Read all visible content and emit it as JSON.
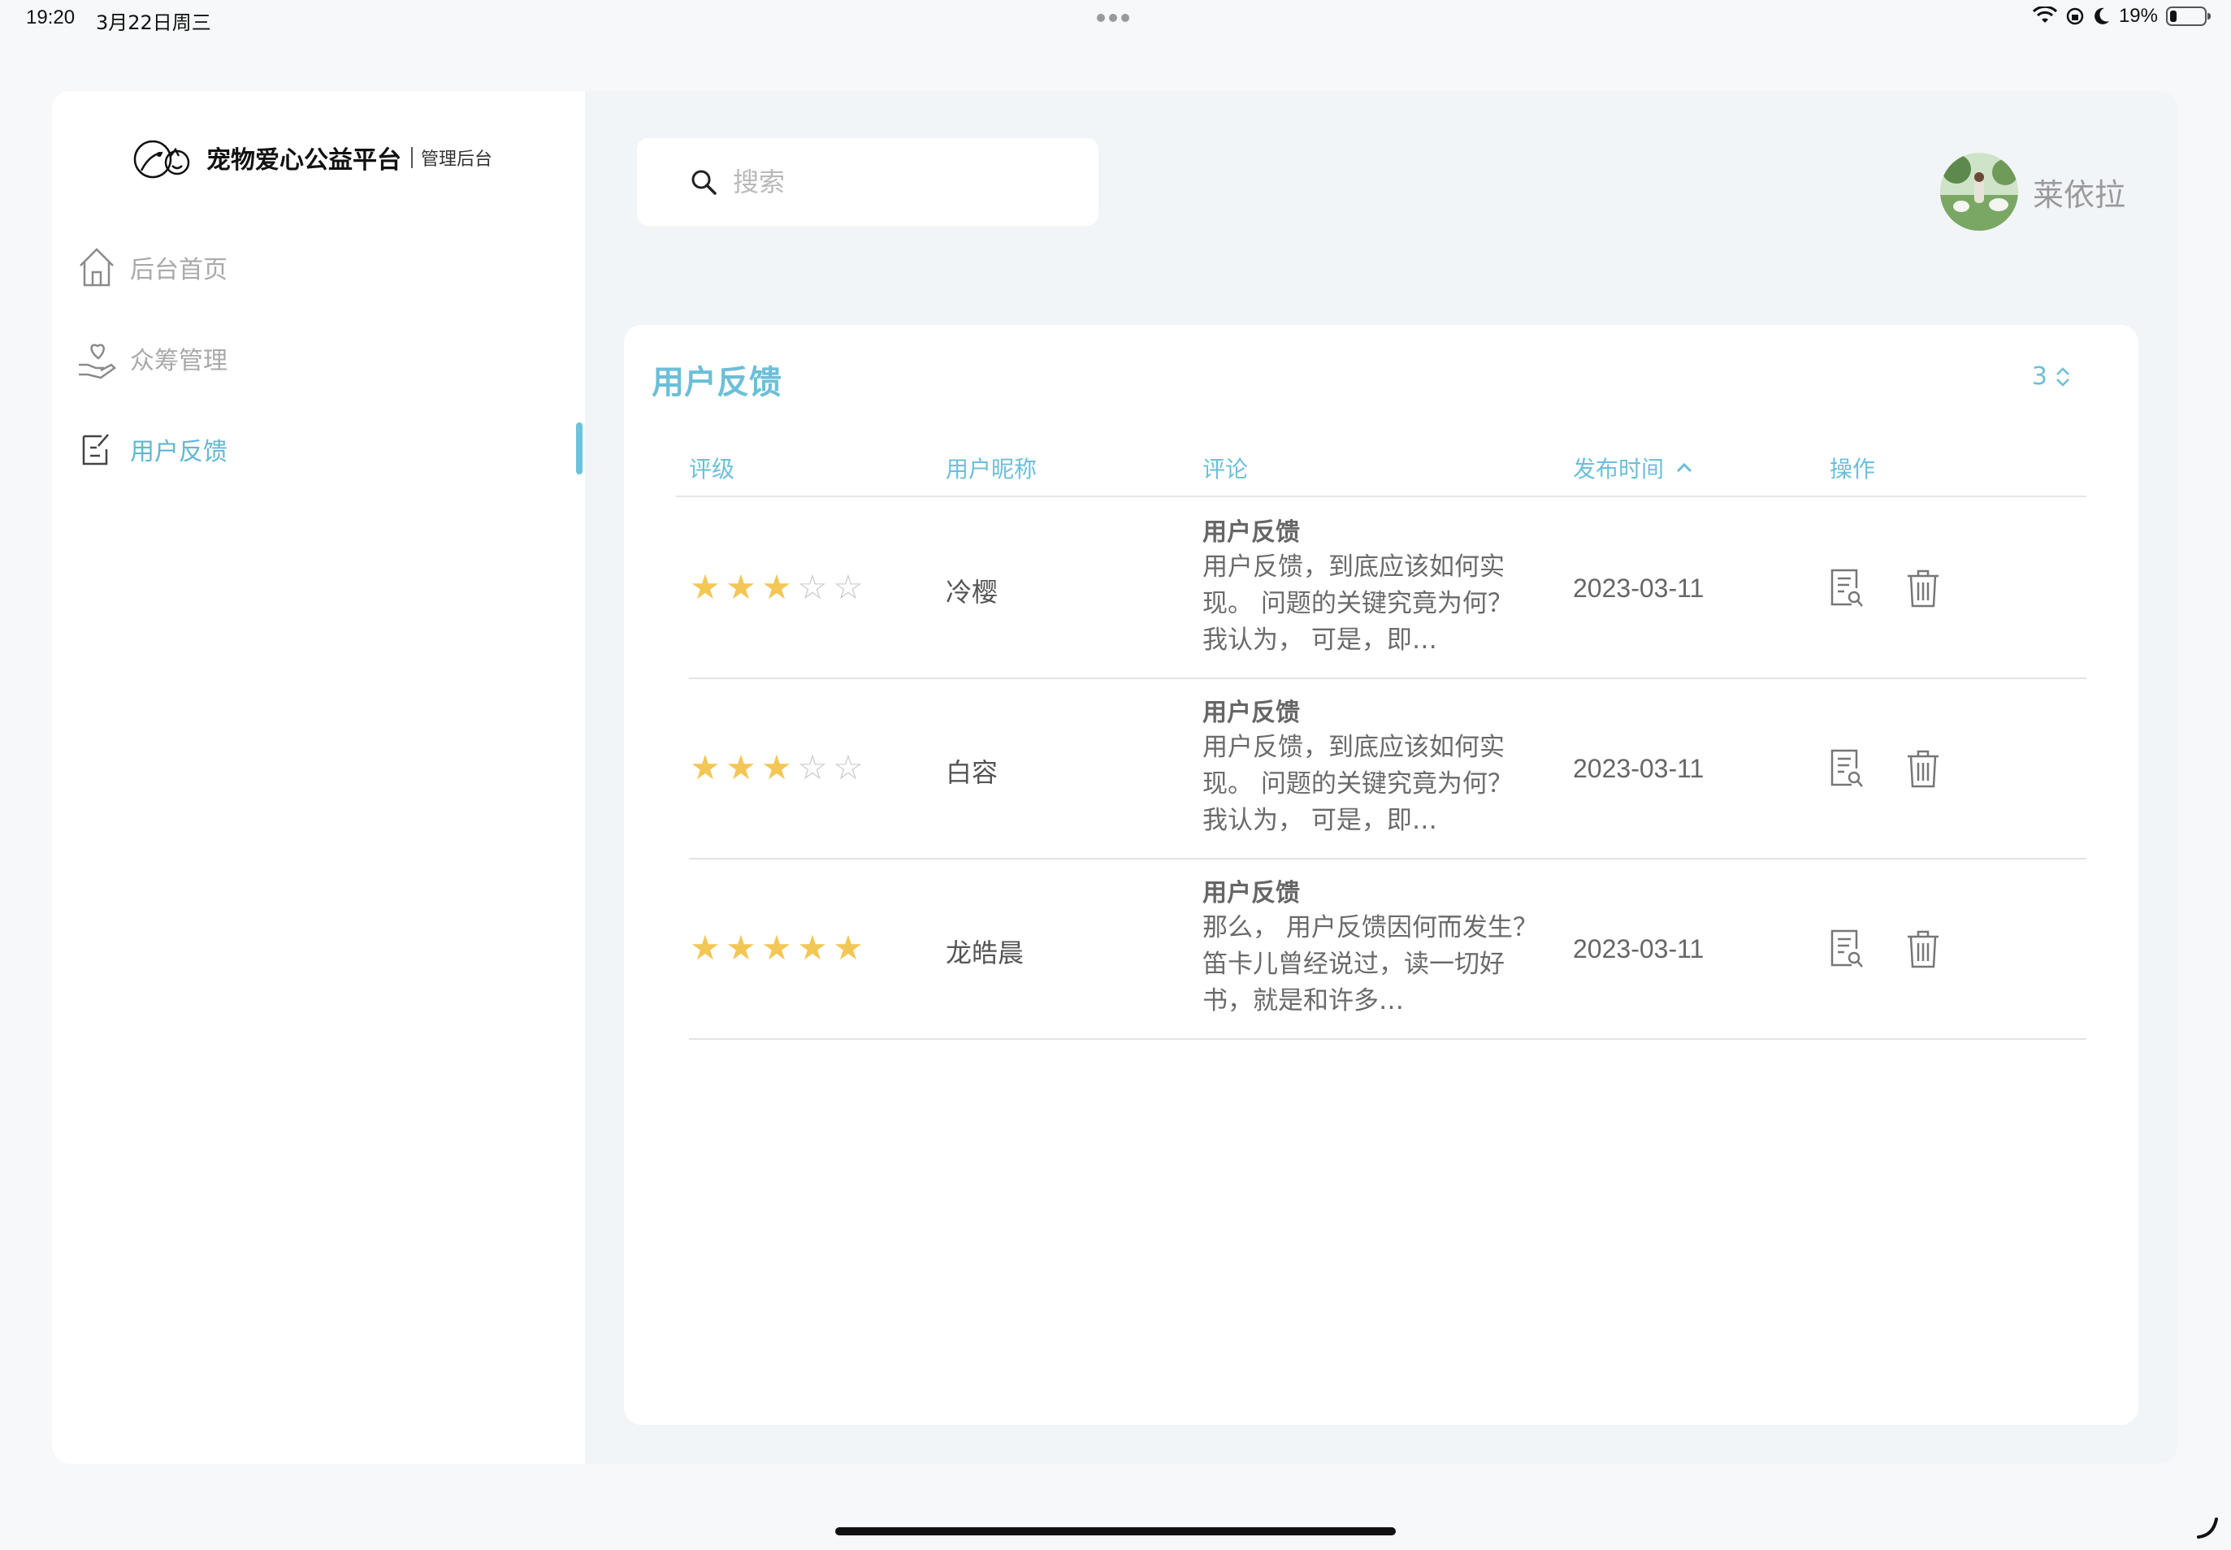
{
  "status_bar": {
    "time": "19:20",
    "date": "3月22日周三",
    "battery": "19%"
  },
  "brand": {
    "name": "宠物爱心公益平台",
    "subtitle": "管理后台"
  },
  "sidebar": {
    "items": [
      {
        "label": "后台首页",
        "icon": "home-icon",
        "active": false
      },
      {
        "label": "众筹管理",
        "icon": "heart-hand-icon",
        "active": false
      },
      {
        "label": "用户反馈",
        "icon": "feedback-doc-icon",
        "active": true
      }
    ]
  },
  "search": {
    "placeholder": "搜索",
    "value": ""
  },
  "user": {
    "name": "莱依拉"
  },
  "card": {
    "title": "用户反馈",
    "page_size": "3"
  },
  "table": {
    "headers": {
      "rating": "评级",
      "nickname": "用户昵称",
      "comment": "评论",
      "time": "发布时间",
      "actions": "操作"
    },
    "rows": [
      {
        "rating": 3,
        "nickname": "冷樱",
        "comment_title": "用户反馈",
        "comment_body": "用户反馈，到底应该如何实现。 问题的关键究竟为何？ 我认为， 可是，即…",
        "date": "2023-03-11"
      },
      {
        "rating": 3,
        "nickname": "白容",
        "comment_title": "用户反馈",
        "comment_body": "用户反馈，到底应该如何实现。 问题的关键究竟为何？ 我认为， 可是，即…",
        "date": "2023-03-11"
      },
      {
        "rating": 5,
        "nickname": "龙皓晨",
        "comment_title": "用户反馈",
        "comment_body": "那么， 用户反馈因何而发生？ 笛卡儿曾经说过，读一切好书，就是和许多…",
        "date": "2023-03-11"
      }
    ]
  },
  "colors": {
    "accent": "#6cbfd8",
    "star": "#f3c756",
    "star_off": "#c9c9c9"
  }
}
